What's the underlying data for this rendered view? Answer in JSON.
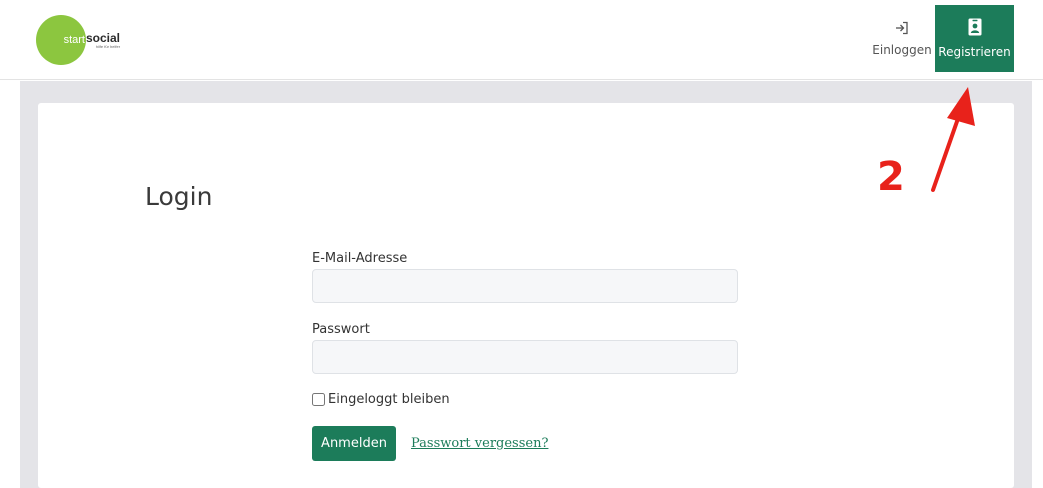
{
  "header": {
    "logo": {
      "start": "start",
      "social": "social",
      "tagline": "hilfe für helfer",
      "brand_color": "#8cc63f"
    },
    "nav": {
      "login": {
        "label": "Einloggen",
        "icon": "login-icon"
      },
      "register": {
        "label": "Registrieren",
        "icon": "id-badge-icon",
        "color": "#1c7c5a"
      }
    }
  },
  "main": {
    "title": "Login",
    "form": {
      "email": {
        "label": "E-Mail-Adresse",
        "value": "",
        "placeholder": ""
      },
      "password": {
        "label": "Passwort",
        "value": "",
        "placeholder": ""
      },
      "remember": {
        "label": "Eingeloggt bleiben",
        "checked": false
      },
      "submit_label": "Anmelden",
      "forgot_label": "Passwort vergessen?"
    }
  },
  "annotation": {
    "number": "2",
    "color": "#e8221b"
  },
  "colors": {
    "accent": "#1c7c5a",
    "background": "#e4e4e8"
  }
}
